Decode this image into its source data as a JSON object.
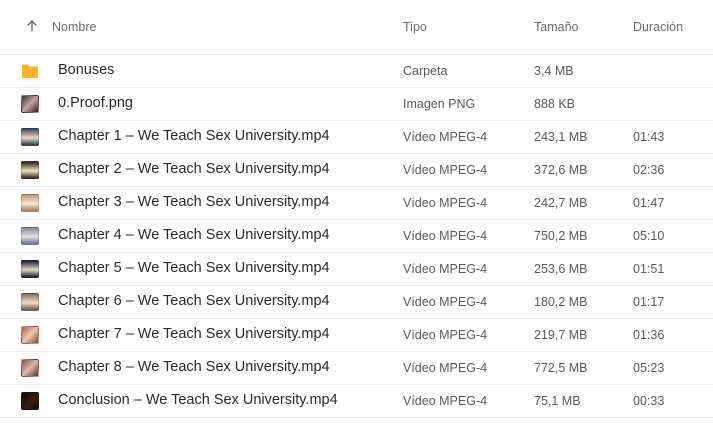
{
  "header": {
    "name": "Nombre",
    "type": "Tipo",
    "size": "Tamaño",
    "duration": "Duración"
  },
  "rows": [
    {
      "name": "Bonuses",
      "type": "Carpeta",
      "size": "3,4 MB",
      "duration": "",
      "icon": "folder-icon"
    },
    {
      "name": "0.Proof.png",
      "type": "Imagen PNG",
      "size": "888 KB",
      "duration": "",
      "icon": "image-thumbnail"
    },
    {
      "name": "Chapter 1 – We Teach Sex University.mp4",
      "type": "Vídeo MPEG-4",
      "size": "243,1 MB",
      "duration": "01:43",
      "icon": "video-thumbnail"
    },
    {
      "name": "Chapter 2 – We Teach Sex University.mp4",
      "type": "Vídeo MPEG-4",
      "size": "372,6 MB",
      "duration": "02:36",
      "icon": "video-thumbnail"
    },
    {
      "name": "Chapter 3 – We Teach Sex University.mp4",
      "type": "Vídeo MPEG-4",
      "size": "242,7 MB",
      "duration": "01:47",
      "icon": "video-thumbnail"
    },
    {
      "name": "Chapter 4 – We Teach Sex University.mp4",
      "type": "Vídeo MPEG-4",
      "size": "750,2 MB",
      "duration": "05:10",
      "icon": "video-thumbnail"
    },
    {
      "name": "Chapter 5 – We Teach Sex University.mp4",
      "type": "Vídeo MPEG-4",
      "size": "253,6 MB",
      "duration": "01:51",
      "icon": "video-thumbnail"
    },
    {
      "name": "Chapter 6 – We Teach Sex University.mp4",
      "type": "Vídeo MPEG-4",
      "size": "180,2 MB",
      "duration": "01:17",
      "icon": "video-thumbnail"
    },
    {
      "name": "Chapter 7 – We Teach Sex University.mp4",
      "type": "Vídeo MPEG-4",
      "size": "219,7 MB",
      "duration": "01:36",
      "icon": "video-thumbnail"
    },
    {
      "name": "Chapter 8 – We Teach Sex University.mp4",
      "type": "Vídeo MPEG-4",
      "size": "772,5 MB",
      "duration": "05:23",
      "icon": "video-thumbnail"
    },
    {
      "name": "Conclusion – We Teach Sex University.mp4",
      "type": "Vídeo MPEG-4",
      "size": "75,1 MB",
      "duration": "00:33",
      "icon": "video-thumbnail"
    }
  ],
  "colors": {
    "folder": "#f7b52c",
    "border": "#ececec"
  }
}
